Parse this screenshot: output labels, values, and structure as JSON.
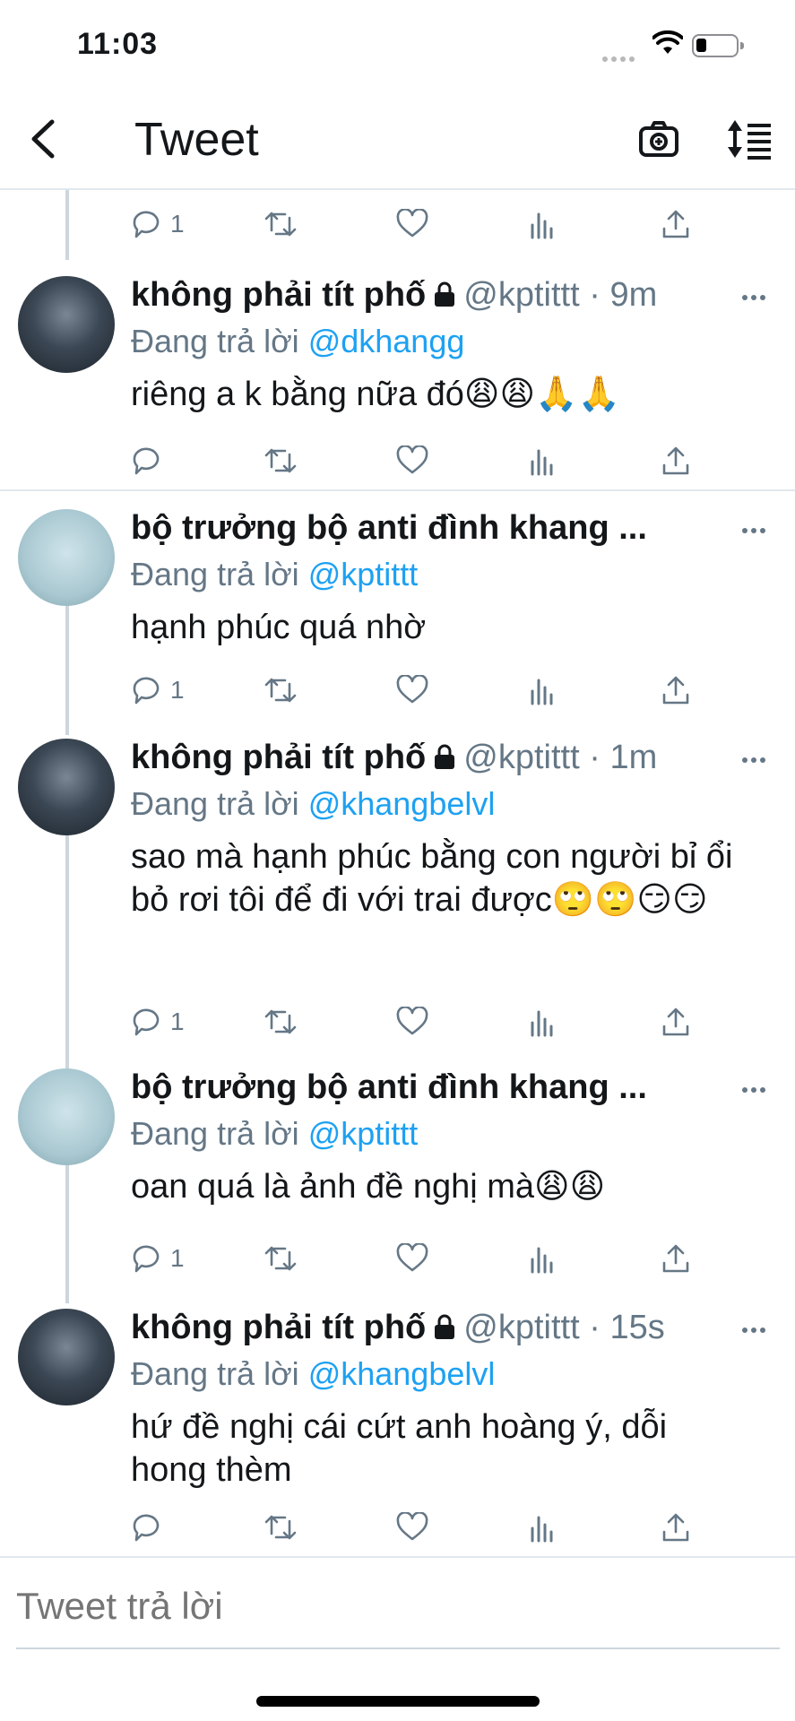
{
  "status_bar": {
    "time": "11:03"
  },
  "nav": {
    "title": "Tweet",
    "back_icon": "chevron-left-icon",
    "camera_icon": "camera-icon",
    "sort_icon": "sort-icon"
  },
  "colors": {
    "link": "#1da1f2",
    "secondary": "#657786",
    "thread_line": "#ccd6dd",
    "divider": "#e1e8ed"
  },
  "top_actions": {
    "reply_count": "1"
  },
  "tweets": [
    {
      "name": "không phải tít phố",
      "protected": true,
      "handle": "@kptittt",
      "sep": " · ",
      "time": "9m",
      "reply_prefix": "Đang trả lời ",
      "reply_to": "@dkhangg",
      "text": "riêng a k bằng nữa đó😩😩🙏🙏",
      "reply_count": ""
    },
    {
      "name": "bộ trưởng bộ anti đình khang ...",
      "protected": false,
      "handle": "",
      "sep": "",
      "time": "",
      "reply_prefix": "Đang trả lời ",
      "reply_to": "@kptittt",
      "text": "hạnh phúc quá nhờ",
      "reply_count": "1"
    },
    {
      "name": "không phải tít phố",
      "protected": true,
      "handle": "@kptittt",
      "sep": " · ",
      "time": "1m",
      "reply_prefix": "Đang trả lời ",
      "reply_to": "@khangbelvl",
      "text": "sao mà hạnh phúc bằng con người bỉ ổi bỏ rơi tôi để đi với trai được🙄🙄😏😏",
      "reply_count": "1"
    },
    {
      "name": "bộ trưởng bộ anti đình khang ...",
      "protected": false,
      "handle": "",
      "sep": "",
      "time": "",
      "reply_prefix": "Đang trả lời ",
      "reply_to": "@kptittt",
      "text": "oan quá là ảnh đề nghị mà😩😩",
      "reply_count": "1"
    },
    {
      "name": "không phải tít phố",
      "protected": true,
      "handle": "@kptittt",
      "sep": " · ",
      "time": "15s",
      "reply_prefix": "Đang trả lời ",
      "reply_to": "@khangbelvl",
      "text": "hứ đề nghị cái cứt anh hoàng ý, dỗi hong thèm",
      "reply_count": ""
    }
  ],
  "compose": {
    "placeholder": "Tweet trả lời"
  }
}
